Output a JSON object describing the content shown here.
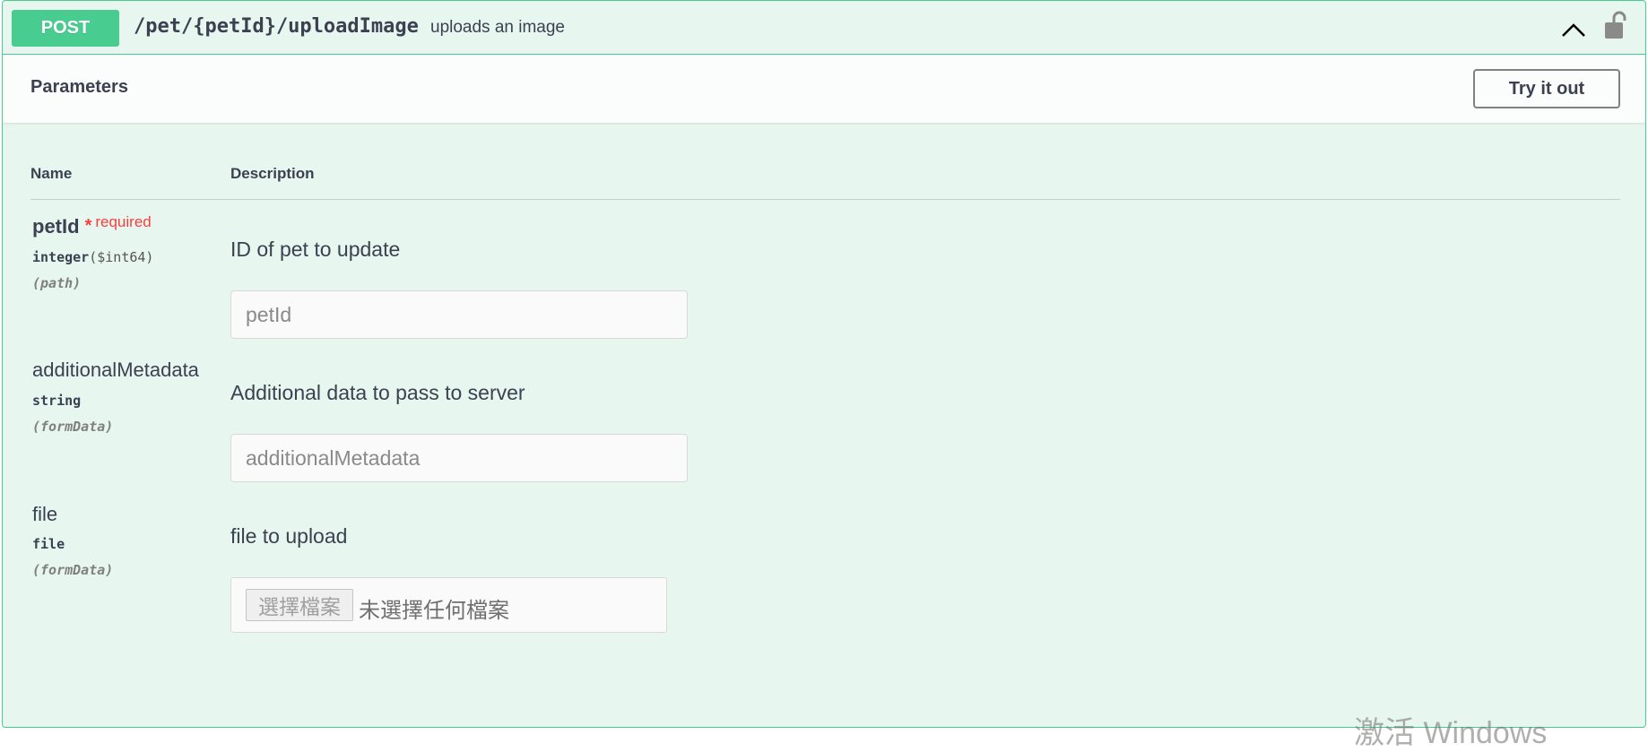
{
  "operation": {
    "method": "POST",
    "path": "/pet/{petId}/uploadImage",
    "summary": "uploads an image",
    "method_color": "#49cc90"
  },
  "section": {
    "title": "Parameters",
    "try_button": "Try it out"
  },
  "table": {
    "col_name": "Name",
    "col_description": "Description"
  },
  "params": [
    {
      "name": "petId",
      "required_star": "*",
      "required_label": "required",
      "type": "integer",
      "format": "($int64)",
      "in": "(path)",
      "description": "ID of pet to update",
      "placeholder": "petId"
    },
    {
      "name": "additionalMetadata",
      "type": "string",
      "in": "(formData)",
      "description": "Additional data to pass to server",
      "placeholder": "additionalMetadata"
    },
    {
      "name": "file",
      "type": "file",
      "in": "(formData)",
      "description": "file to upload",
      "file_button": "選擇檔案",
      "file_status": "未選擇任何檔案"
    }
  ],
  "icons": {
    "collapse": "chevron-up-icon",
    "auth": "unlocked-icon"
  },
  "watermark": "激活 Windows"
}
